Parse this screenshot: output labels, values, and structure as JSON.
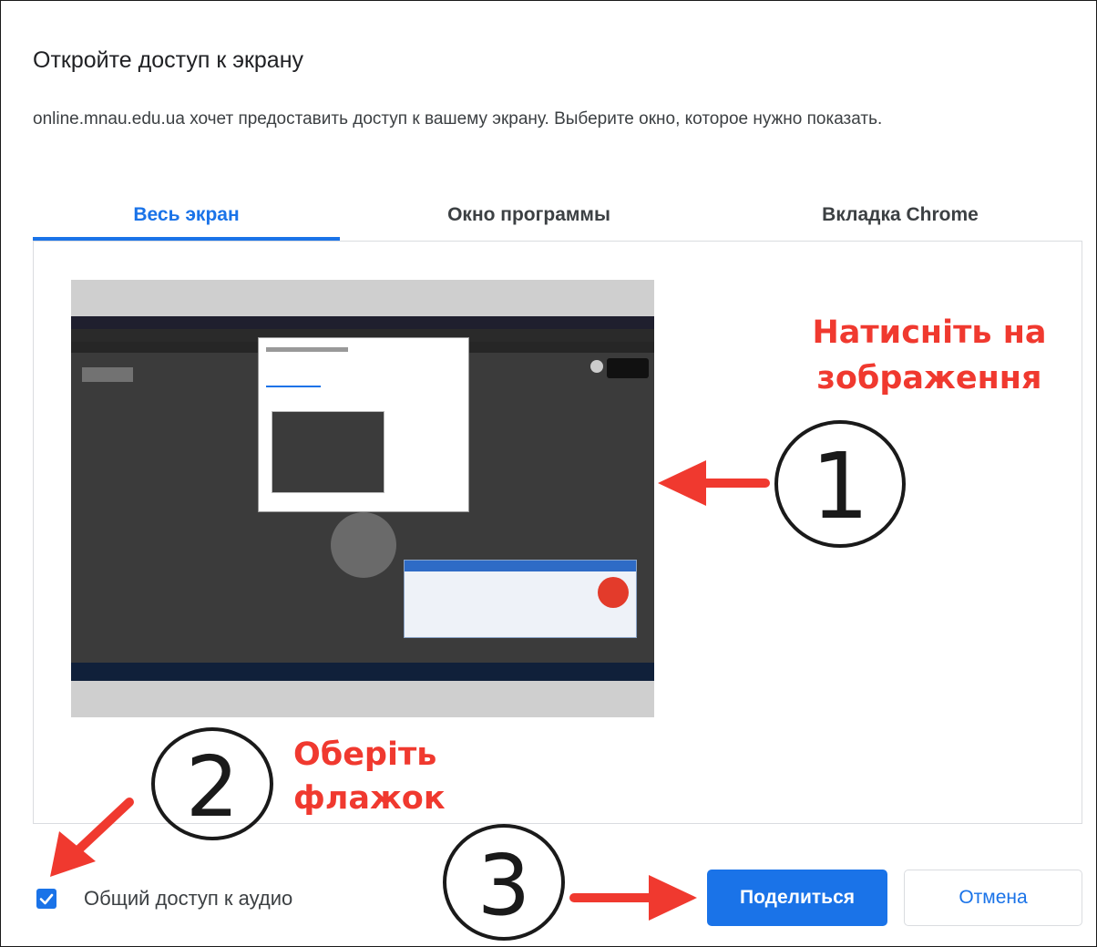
{
  "dialog": {
    "title": "Откройте доступ к экрану",
    "description": "online.mnau.edu.ua хочет предоставить доступ к вашему экрану. Выберите окно, которое нужно показать."
  },
  "tabs": [
    {
      "label": "Весь экран",
      "active": true
    },
    {
      "label": "Окно программы",
      "active": false
    },
    {
      "label": "Вкладка Chrome",
      "active": false
    }
  ],
  "annotations": {
    "step1_text": "Натисніть на зображення",
    "step1_line1": "Натисніть на",
    "step1_line2": "зображення",
    "step2_line1": "Оберіть",
    "step2_line2": "флажок",
    "step_numbers": [
      "1",
      "2",
      "3"
    ],
    "annotation_color": "#f0392f"
  },
  "audio": {
    "label": "Общий доступ к аудио",
    "checked": true
  },
  "buttons": {
    "share": "Поделиться",
    "cancel": "Отмена"
  },
  "colors": {
    "accent": "#1a73e8",
    "text": "#202124"
  }
}
